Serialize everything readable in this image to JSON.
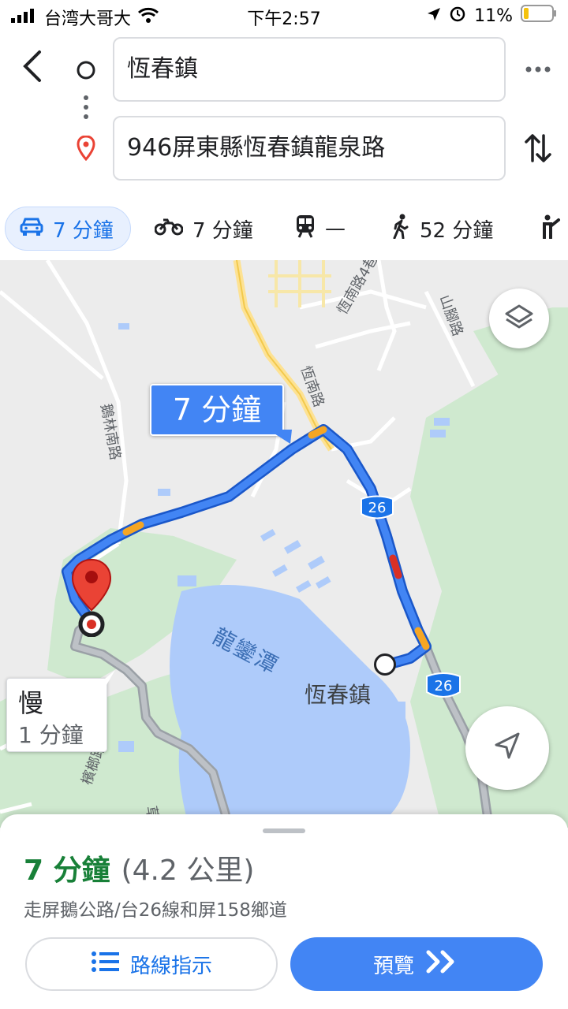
{
  "status": {
    "carrier": "台湾大哥大",
    "time": "下午2:57",
    "battery": "11%"
  },
  "search": {
    "origin": "恆春鎮",
    "destination": "946屏東縣恆春鎮龍泉路"
  },
  "modes": [
    {
      "name": "drive",
      "label": "7 分鐘"
    },
    {
      "name": "motorcycle",
      "label": "7 分鐘"
    },
    {
      "name": "transit",
      "label": "—"
    },
    {
      "name": "walk",
      "label": "52 分鐘"
    }
  ],
  "map": {
    "route_bubble": "7 分鐘",
    "alt_title": "慢",
    "alt_time": "1 分鐘",
    "lake_label": "龍鑾潭",
    "town_label": "恆春鎮",
    "road_labels": [
      "恆南路4巷",
      "恆南路",
      "山腳路",
      "鵝林南路",
      "檳榔路",
      "草"
    ],
    "highway_shield": "26"
  },
  "sheet": {
    "duration": "7 分鐘",
    "distance": "(4.2 公里)",
    "via": "走屏鵝公路/台26線和屏158鄉道",
    "steps_label": "路線指示",
    "preview_label": "預覽"
  },
  "colors": {
    "accent": "#4285f4",
    "route": "#3b78e7",
    "duration_green": "#188038",
    "traffic_orange": "#f6a623",
    "traffic_red": "#d93025"
  }
}
